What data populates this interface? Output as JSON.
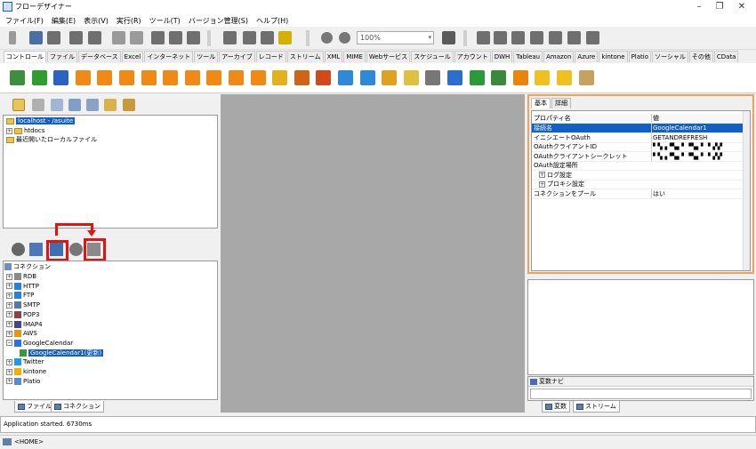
{
  "window": {
    "title": "フローデザイナー",
    "controls": [
      "–",
      "❐",
      "✕"
    ]
  },
  "menu": [
    "ファイル(F)",
    "編集(E)",
    "表示(V)",
    "実行(R)",
    "ツール(T)",
    "バージョン管理(S)",
    "ヘルプ(H)"
  ],
  "toolbar": {
    "zoom_value": "100%"
  },
  "palette_tabs": [
    "コントロール",
    "ファイル",
    "データベース",
    "Excel",
    "インターネット",
    "ツール",
    "アーカイブ",
    "レコード",
    "ストリーム",
    "XML",
    "MIME",
    "Webサービス",
    "スケジュール",
    "アカウント",
    "DWH",
    "Tableau",
    "Amazon",
    "Azure",
    "kintone",
    "Platio",
    "ソーシャル",
    "その他",
    "CData"
  ],
  "palette_active_tab": "コントロール",
  "palette_icons": [
    "flow-start-icon",
    "end-icon",
    "stop-icon",
    "condition-icon",
    "text-assign-icon",
    "expression-assign-icon",
    "branch-icon",
    "loop-icon",
    "loop-end-icon",
    "break-icon",
    "continue-icon",
    "merge-icon",
    "variable-icon",
    "counter-icon",
    "exception-icon",
    "parallel-icon",
    "script-icon",
    "subflow-icon",
    "sleep-icon",
    "log-icon",
    "notify-icon",
    "external-icon",
    "call-icon",
    "wait-icon",
    "upload-icon",
    "download-icon",
    "link-icon"
  ],
  "file_tree": {
    "items": [
      {
        "label": "localhost - /asuite",
        "selected": true,
        "level": 0
      },
      {
        "label": "htdocs",
        "level": 1
      },
      {
        "label": "最近開いたローカルファイル",
        "level": 0
      }
    ]
  },
  "connection_tree": {
    "root": "コネクション",
    "items": [
      {
        "label": "RDB",
        "level": 1
      },
      {
        "label": "HTTP",
        "level": 1
      },
      {
        "label": "FTP",
        "level": 1
      },
      {
        "label": "SMTP",
        "level": 1
      },
      {
        "label": "POP3",
        "level": 1
      },
      {
        "label": "IMAP4",
        "level": 1
      },
      {
        "label": "AWS",
        "level": 1
      },
      {
        "label": "GoogleCalendar",
        "level": 1
      },
      {
        "label": "GoogleCalendar1(更新)",
        "level": 2,
        "selected": true
      },
      {
        "label": "Twitter",
        "level": 1
      },
      {
        "label": "kintone",
        "level": 1
      },
      {
        "label": "Platio",
        "level": 1
      }
    ]
  },
  "left_tabs": [
    "ファイル",
    "コネクション"
  ],
  "properties": {
    "tabs": [
      "基本",
      "詳細"
    ],
    "header": {
      "key": "プロパティ名",
      "value": "値"
    },
    "rows": [
      {
        "key": "接続名",
        "value": "GoogleCalendar1",
        "selected": true
      },
      {
        "key": "イニシエートOAuth",
        "value": "GETANDREFRESH"
      },
      {
        "key": "OAuthクライアントID",
        "value": "▘▚▗▝▚▖▘▝▚▖▘▝▗▚▘"
      },
      {
        "key": "OAuthクライアントシークレット",
        "value": "▘▚▗▝▚▖▘▝▚▖▘▝▗▚▘"
      },
      {
        "key": "OAuth設定場所",
        "value": ""
      },
      {
        "key": "ログ設定",
        "value": "",
        "expandable": true
      },
      {
        "key": "プロキシ設定",
        "value": "",
        "expandable": true
      },
      {
        "key": "コネクションをプール",
        "value": "はい"
      }
    ]
  },
  "variable_navi": {
    "label": "変数ナビ"
  },
  "right_tabs": [
    "変数",
    "ストリーム"
  ],
  "console": {
    "message": "Application started. 6730ms"
  },
  "status": {
    "text": "<HOME>"
  }
}
